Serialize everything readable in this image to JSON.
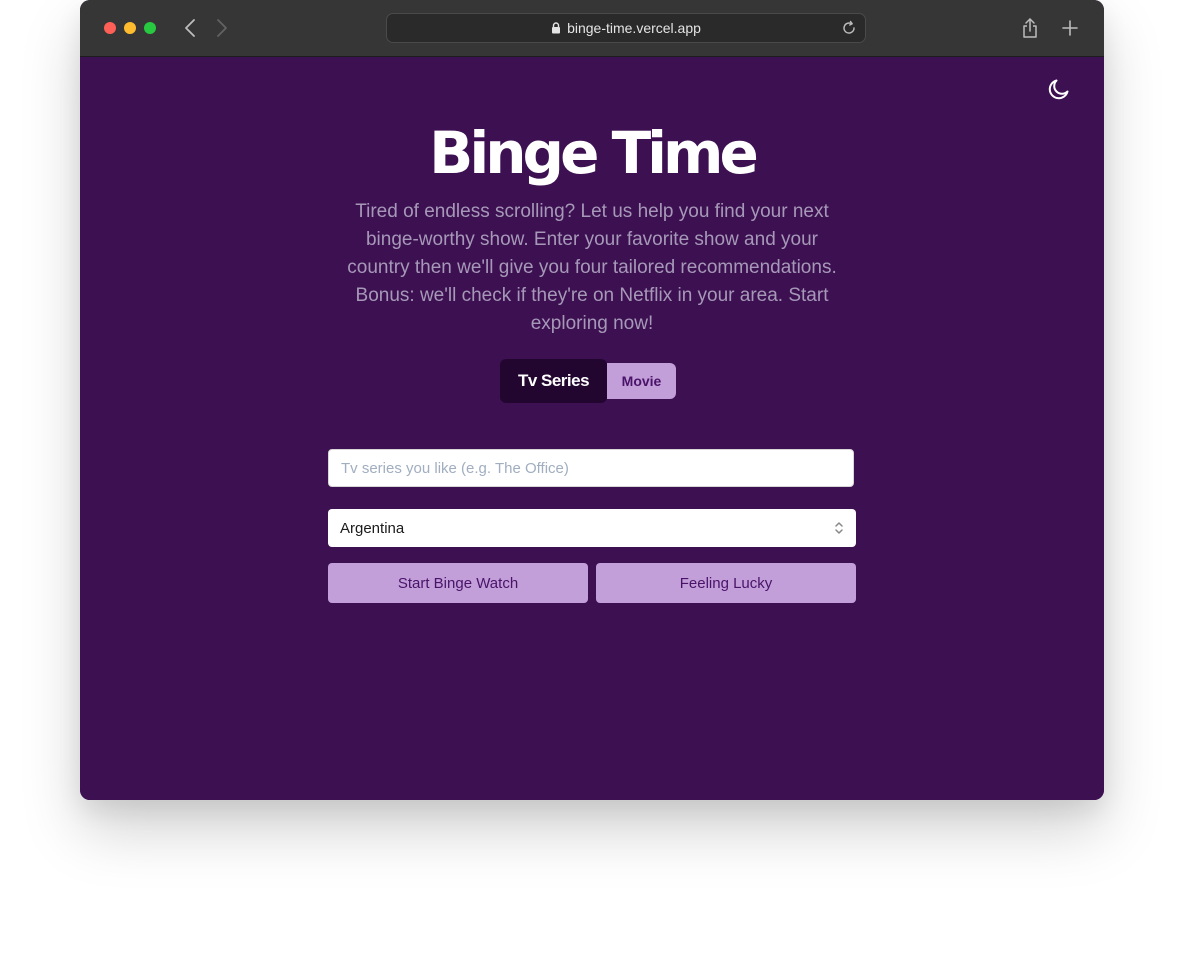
{
  "browser": {
    "url": "binge-time.vercel.app"
  },
  "app": {
    "title": "Binge Time",
    "description": "Tired of endless scrolling? Let us help you find your next binge-worthy show. Enter your favorite show and your country then we'll give you four tailored recommendations. Bonus: we'll check if they're on Netflix in your area. Start exploring now!",
    "theme_toggle_icon": "moon-icon"
  },
  "media_toggle": {
    "options": [
      "Tv Series",
      "Movie"
    ],
    "selected": "Tv Series"
  },
  "form": {
    "show_input": {
      "value": "",
      "placeholder": "Tv series you like (e.g. The Office)"
    },
    "country_select": {
      "selected": "Argentina"
    },
    "start_button": "Start Binge Watch",
    "lucky_button": "Feeling Lucky"
  },
  "colors": {
    "background": "#3d1052",
    "accent": "#c29fd8",
    "accent_text": "#4a136a",
    "toggle_active": "#230630"
  }
}
